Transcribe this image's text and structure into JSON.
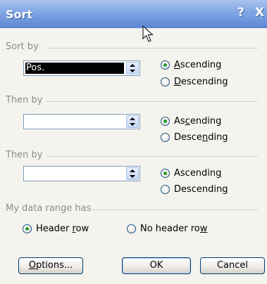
{
  "window": {
    "title": "Sort",
    "help_btn": "?",
    "close_btn": "X"
  },
  "sort_by": {
    "label": "Sort by",
    "value": "Pos.",
    "asc_pre": "",
    "asc_u": "A",
    "asc_post": "scending",
    "desc_pre": "",
    "desc_u": "D",
    "desc_post": "escending"
  },
  "then_by_1": {
    "label": "Then by",
    "value": "",
    "asc_pre": "As",
    "asc_u": "c",
    "asc_post": "ending",
    "desc_pre": "Desce",
    "desc_u": "n",
    "desc_post": "ding"
  },
  "then_by_2": {
    "label": "Then by",
    "value": "",
    "asc_pre": "Ascendin",
    "asc_u": "g",
    "asc_post": "",
    "desc_pre": "Descendin",
    "desc_u": "g",
    "desc_post": ""
  },
  "data_range": {
    "label": "My data range has",
    "header_pre": "Header ",
    "header_u": "r",
    "header_post": "ow",
    "noheader_pre": "No header ro",
    "noheader_u": "w",
    "noheader_post": ""
  },
  "buttons": {
    "options_pre": "",
    "options_u": "O",
    "options_post": "ptions...",
    "ok": "OK",
    "cancel": "Cancel"
  }
}
